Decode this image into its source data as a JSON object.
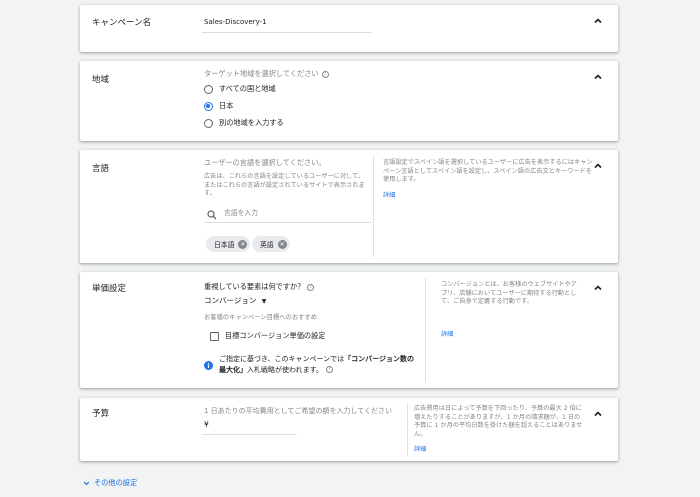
{
  "campaign_name": {
    "title": "キャンペーン名",
    "value": "Sales-Discovery-1"
  },
  "location": {
    "title": "地域",
    "prompt": "ターゲット地域を選択してください",
    "options": [
      {
        "label": "すべての国と地域",
        "selected": false
      },
      {
        "label": "日本",
        "selected": true
      },
      {
        "label": "別の地域を入力する",
        "selected": false
      }
    ]
  },
  "language": {
    "title": "言語",
    "prompt": "ユーザーの言語を選択してください。",
    "description": "広告は、これらの言語を設定しているユーザーに対して、またはこれらの言語が設定されているサイトで表示されます。",
    "search_placeholder": "言語を入力",
    "chips": [
      "日本語",
      "英語"
    ],
    "help_text": "言語設定でスペイン語を選択しているユーザーに広告を表示するにはキャンペーン言語としてスペイン語を設定し、スペイン語の広告文とキーワードを使用します。",
    "help_link": "詳細"
  },
  "bidding": {
    "title": "単価設定",
    "question": "重視している要素は何ですか？",
    "dropdown_value": "コンバージョン",
    "recommendation": "お客様のキャンペーン目標へのおすすめ",
    "checkbox_label": "目標コンバージョン単価の設定",
    "info_prefix": "ご指定に基づき、このキャンペーンでは",
    "info_bold": "「コンバージョン数の最大化」",
    "info_suffix": "入札戦略が使われます。",
    "help_text": "コンバージョンとは、お客様のウェブサイトやアプリ、店舗においてユーザーに期待する行動として、ご自身で定義する行動です。",
    "help_link": "詳細"
  },
  "budget": {
    "title": "予算",
    "prompt": "1 日あたりの平均費用としてご希望の額を入力してください",
    "currency": "¥",
    "help_text": "広告費用は日によって予算を下回ったり、予算の最大 2 倍に増えたりすることがありますが、1 か月の請求額が、1 日の予算に 1 か月の平均日数を掛けた額を超えることはありません。",
    "help_link": "詳細"
  },
  "other_settings": {
    "label": "その他の設定"
  },
  "colors": {
    "accent": "#1a73e8",
    "background": "#f1f3f4"
  }
}
